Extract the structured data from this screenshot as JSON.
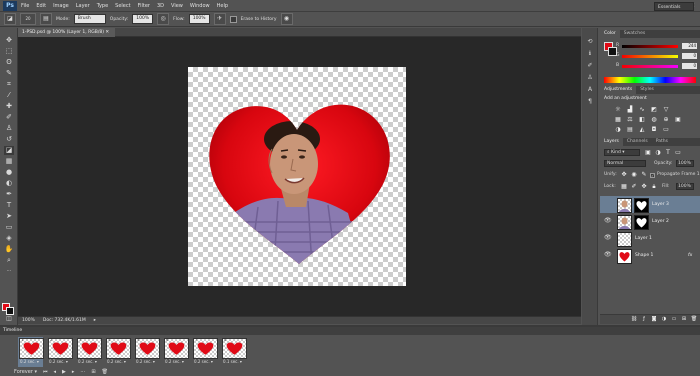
{
  "app": {
    "logo": "Ps"
  },
  "menu": [
    "File",
    "Edit",
    "Image",
    "Layer",
    "Type",
    "Select",
    "Filter",
    "3D",
    "View",
    "Window",
    "Help"
  ],
  "window_controls": [
    "—",
    "□",
    "✕"
  ],
  "options": {
    "brush_size": "20",
    "mode_label": "Mode:",
    "mode_value": "Brush",
    "opacity_label": "Opacity:",
    "opacity_value": "100%",
    "flow_label": "Flow:",
    "flow_value": "100%",
    "erase_history": "Erase to History",
    "workspace": "Essentials"
  },
  "document": {
    "tab_title": "1-PSD.psd @ 100% (Layer 1, RGB/8)",
    "zoom": "100%",
    "doc_size": "Doc: 732.4K/1.61M"
  },
  "color_panel": {
    "tabs": [
      "Color",
      "Swatches"
    ],
    "channels": [
      {
        "label": "R",
        "value": "244"
      },
      {
        "label": "G",
        "value": "0"
      },
      {
        "label": "B",
        "value": "0"
      }
    ]
  },
  "adjustments_panel": {
    "tabs": [
      "Adjustments",
      "Styles"
    ],
    "heading": "Add an adjustment"
  },
  "layers_panel": {
    "tabs": [
      "Layers",
      "Channels",
      "Paths"
    ],
    "filter_kind": "Kind",
    "blend_mode": "Normal",
    "opacity_label": "Opacity:",
    "opacity_value": "100%",
    "unify_label": "Unify:",
    "propagate_label": "Propagate Frame 1",
    "lock_label": "Lock:",
    "fill_label": "Fill:",
    "fill_value": "100%",
    "layers": [
      {
        "name": "Layer 3",
        "visible": false,
        "selected": true,
        "mask": true
      },
      {
        "name": "Layer 2",
        "visible": true,
        "selected": false,
        "mask": true
      },
      {
        "name": "Layer 1",
        "visible": true,
        "selected": false,
        "mask": false
      },
      {
        "name": "Shape 1",
        "visible": true,
        "selected": false,
        "mask": false,
        "fx": "fx"
      }
    ]
  },
  "timeline": {
    "title": "Timeline",
    "frames": [
      {
        "num": "1",
        "delay": "0.2 sec. ▾"
      },
      {
        "num": "2",
        "delay": "0.2 sec. ▾"
      },
      {
        "num": "3",
        "delay": "0.2 sec. ▾"
      },
      {
        "num": "4",
        "delay": "0.2 sec. ▾"
      },
      {
        "num": "5",
        "delay": "0.2 sec. ▾"
      },
      {
        "num": "6",
        "delay": "0.2 sec. ▾"
      },
      {
        "num": "7",
        "delay": "0.2 sec. ▾"
      },
      {
        "num": "8",
        "delay": "0.1 sec. ▾"
      }
    ],
    "loop": "Forever"
  },
  "colors": {
    "foreground": "#e00b17",
    "background": "#111111",
    "heart": "#e00b17",
    "selection": "#6a7e94"
  }
}
